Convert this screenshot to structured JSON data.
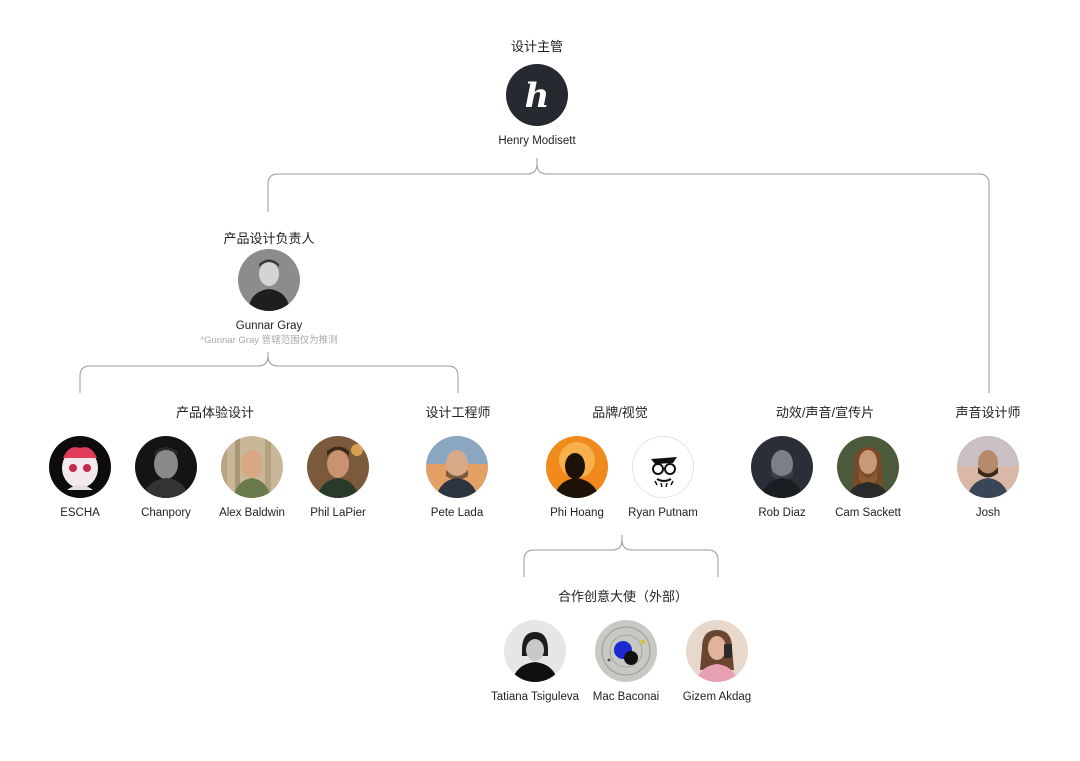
{
  "head": {
    "title": "设计主管",
    "name": "Henry Modisett",
    "logo_letter": "h"
  },
  "product_lead": {
    "title": "产品设计负责人",
    "name": "Gunnar Gray",
    "note": "*Gunnar Gray 管辖范围仅为推测"
  },
  "groups": {
    "product_experience": {
      "title": "产品体验设计",
      "members": [
        "ESCHA",
        "Chanpory",
        "Alex Baldwin",
        "Phil LaPier"
      ]
    },
    "design_engineer": {
      "title": "设计工程师",
      "members": [
        "Pete Lada"
      ]
    },
    "brand_visual": {
      "title": "品牌/视觉",
      "members": [
        "Phi Hoang",
        "Ryan Putnam"
      ]
    },
    "motion_sound": {
      "title": "动效/声音/宣传片",
      "members": [
        "Rob Diaz",
        "Cam Sackett"
      ]
    },
    "sound_designer": {
      "title": "声音设计师",
      "members": [
        "Josh"
      ]
    },
    "ambassadors": {
      "title": "合作创意大使（外部）",
      "members": [
        "Tatiana Tsiguleva",
        "Mac Baconai",
        "Gizem Akdag"
      ]
    }
  },
  "colors": {
    "line": "#9a9a9a",
    "logo_bg": "#262a30",
    "note": "#a8a8a8"
  }
}
